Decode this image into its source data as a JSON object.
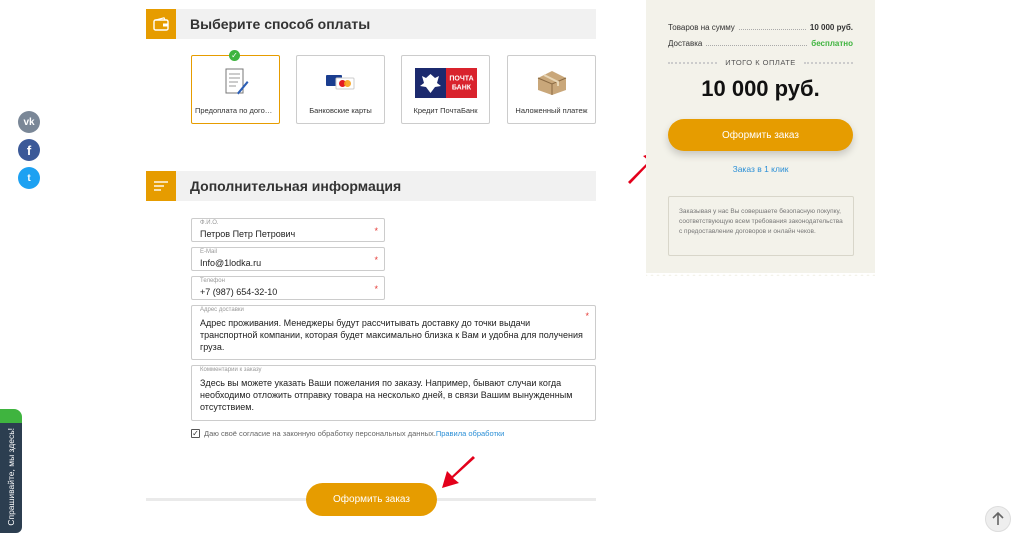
{
  "social": {
    "vk": "vk",
    "fb": "f",
    "tw": "t"
  },
  "feedback_tab": "Спрашивайте, мы здесь!",
  "payment": {
    "title": "Выберите способ оплаты",
    "methods": [
      {
        "label": "Предоплата по договору",
        "icon": "contract-icon",
        "selected": true
      },
      {
        "label": "Банковские карты",
        "icon": "bank-cards-icon",
        "selected": false
      },
      {
        "label": "Кредит ПочтаБанк",
        "icon": "pochtabank-logo",
        "selected": false,
        "logo_text_1": "ПОЧТА",
        "logo_text_2": "БАНК"
      },
      {
        "label": "Наложенный платеж",
        "icon": "parcel-icon",
        "selected": false
      }
    ]
  },
  "info": {
    "title": "Дополнительная информация",
    "fio": {
      "label": "Ф.И.О.",
      "value": "Петров Петр Петрович"
    },
    "email": {
      "label": "E-Mail",
      "value": "Info@1lodka.ru"
    },
    "phone": {
      "label": "Телефон",
      "value": "+7 (987) 654-32-10"
    },
    "address": {
      "label": "Адрес доставки",
      "value": "Адрес проживания. Менеджеры будут рассчитывать доставку до точки выдачи транспортной компании, которая будет максимально близка к Вам и удобна для получения груза."
    },
    "comment": {
      "label": "Комментарии к заказу",
      "value": "Здесь вы можете указать Ваши пожелания по заказу. Например, бывают случаи когда необходимо отложить отправку товара на несколько дней, в связи Вашим вынужденным отсутствием."
    },
    "required_mark": "*"
  },
  "consent": {
    "text": "Даю своё согласие на законную обработку персональных данных.",
    "link": "Правила обработки",
    "checked": true
  },
  "submit_label": "Оформить заказ",
  "summary": {
    "goods_label": "Товаров на сумму",
    "goods_value": "10 000 руб.",
    "delivery_label": "Доставка",
    "delivery_value": "бесплатно",
    "total_caption": "ИТОГО К ОПЛАТЕ",
    "total": "10 000 руб.",
    "button": "Оформить заказ",
    "one_click": "Заказ в 1 клик",
    "note": "Заказывая у нас Вы совершаете безопасную покупку, соответствующую всем требования законодательства с предоставление договоров и онлайн чеков."
  },
  "colors": {
    "accent": "#e69c00",
    "green": "#3fb43f",
    "link": "#2b8fd6",
    "arrow": "#e3001b"
  }
}
